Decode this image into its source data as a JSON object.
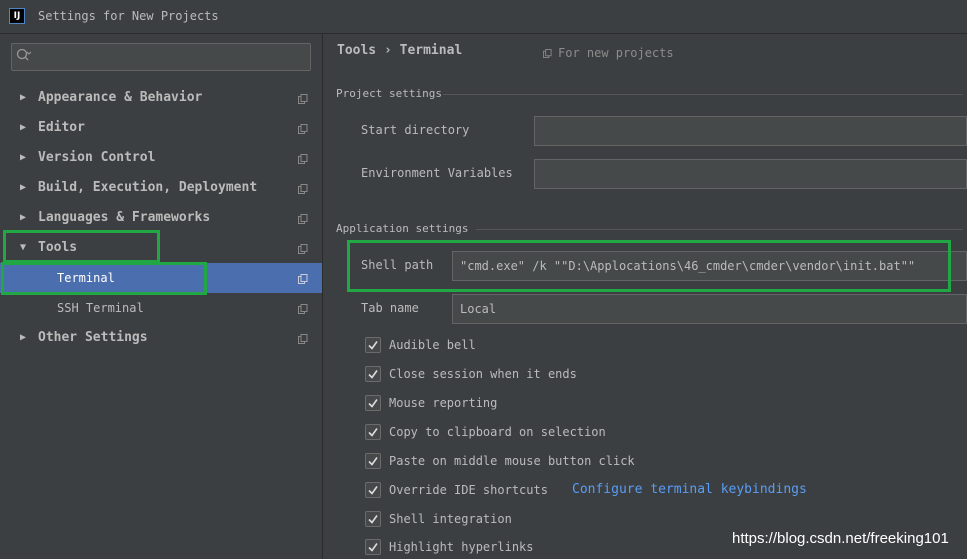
{
  "window": {
    "title": "Settings for New Projects",
    "app_icon": "IJ"
  },
  "sidebar": {
    "search": {
      "placeholder": "",
      "icon": "search-icon"
    },
    "items": [
      {
        "label": "Appearance & Behavior",
        "expanded": false,
        "level": 0
      },
      {
        "label": "Editor",
        "expanded": false,
        "level": 0
      },
      {
        "label": "Version Control",
        "expanded": false,
        "level": 0
      },
      {
        "label": "Build, Execution, Deployment",
        "expanded": false,
        "level": 0
      },
      {
        "label": "Languages & Frameworks",
        "expanded": false,
        "level": 0
      },
      {
        "label": "Tools",
        "expanded": true,
        "level": 0
      },
      {
        "label": "Terminal",
        "level": 1,
        "selected": true
      },
      {
        "label": "SSH Terminal",
        "level": 1
      },
      {
        "label": "Other Settings",
        "expanded": false,
        "level": 0
      }
    ],
    "arrow_collapsed": "▶",
    "arrow_expanded": "▼"
  },
  "main": {
    "breadcrumb": "Tools › Terminal",
    "scope_note": "For new projects",
    "project_settings": {
      "title": "Project settings",
      "start_directory_label": "Start directory",
      "start_directory_value": "",
      "env_vars_label": "Environment Variables",
      "env_vars_value": ""
    },
    "application_settings": {
      "title": "Application settings",
      "shell_path_label": "Shell path",
      "shell_path_value": "\"cmd.exe\" /k \"\"D:\\Applocations\\46_cmder\\cmder\\vendor\\init.bat\"\"",
      "tab_name_label": "Tab name",
      "tab_name_value": "Local"
    },
    "checkboxes": [
      {
        "label": "Audible bell",
        "checked": true
      },
      {
        "label": "Close session when it ends",
        "checked": true
      },
      {
        "label": "Mouse reporting",
        "checked": true
      },
      {
        "label": "Copy to clipboard on selection",
        "checked": true
      },
      {
        "label": "Paste on middle mouse button click",
        "checked": true
      },
      {
        "label": "Override IDE shortcuts",
        "checked": true
      },
      {
        "label": "Shell integration",
        "checked": true
      },
      {
        "label": "Highlight hyperlinks",
        "checked": true
      }
    ],
    "keybindings_link": "Configure terminal keybindings"
  },
  "watermark": "https://blog.csdn.net/freeking101",
  "colors": {
    "background": "#3c3f41",
    "selection": "#4b6eaf",
    "highlight_box": "#21a845",
    "link": "#589df6",
    "field_bg": "#45494a"
  }
}
